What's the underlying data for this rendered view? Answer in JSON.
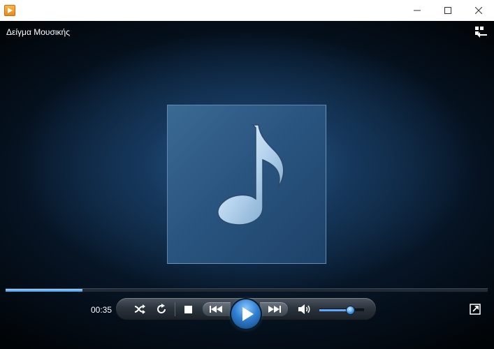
{
  "window": {
    "app_icon": "media-player-icon",
    "controls": [
      "minimize-icon",
      "maximize-icon",
      "close-icon"
    ]
  },
  "now_playing": {
    "title": "Δείγμα Μουσικής",
    "album_art_icon": "music-note-icon"
  },
  "toolbar": {
    "switch_to_library_icon": "switch-to-library-icon"
  },
  "playback": {
    "elapsed": "00:35",
    "progress_fraction": 0.16,
    "volume_fraction": 0.68
  },
  "controls": {
    "shuffle_icon": "shuffle-icon",
    "repeat_icon": "repeat-icon",
    "stop_icon": "stop-icon",
    "previous_icon": "previous-icon",
    "play_icon": "play-icon",
    "next_icon": "next-icon",
    "volume_icon": "speaker-icon",
    "fullscreen_icon": "fullscreen-icon"
  },
  "colors": {
    "accent": "#3d8fe0",
    "title_bar": "#ffffff",
    "stage": "#0f2a47"
  }
}
